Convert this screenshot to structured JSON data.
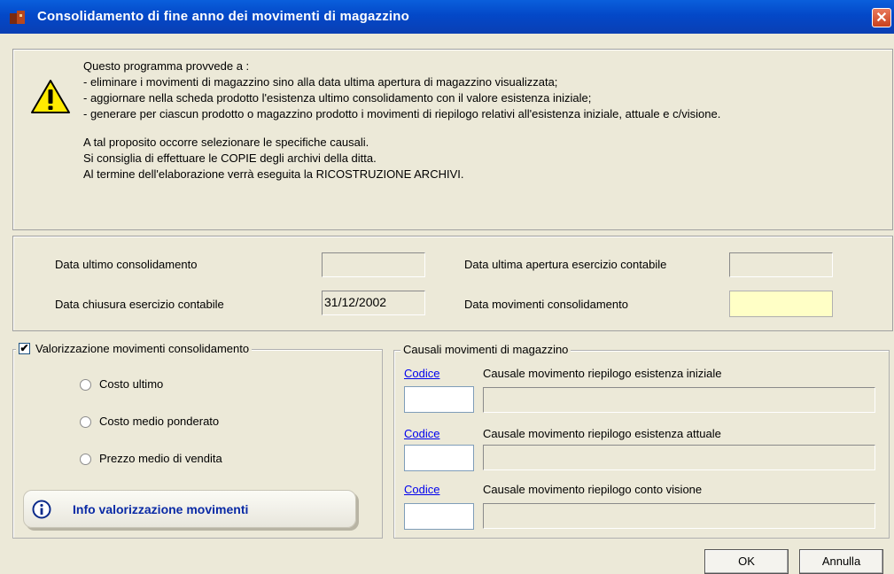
{
  "window": {
    "title": "Consolidamento di fine anno dei movimenti di magazzino",
    "close_label": "✕"
  },
  "info": {
    "lines": [
      "Questo programma provvede a :",
      "- eliminare i movimenti di magazzino sino alla data ultima apertura di magazzino visualizzata;",
      "- aggiornare nella scheda prodotto l'esistenza ultimo consolidamento con il valore esistenza iniziale;",
      "- generare per ciascun prodotto o magazzino prodotto i movimenti di riepilogo relativi all'esistenza iniziale, attuale e c/visione.",
      "",
      "A tal proposito occorre selezionare le specifiche causali.",
      "Si consiglia di effettuare le COPIE degli archivi della ditta.",
      "Al termine dell'elaborazione verrà eseguita la RICOSTRUZIONE ARCHIVI."
    ]
  },
  "dates": {
    "ultimo_consolidamento_label": "Data ultimo consolidamento",
    "ultimo_consolidamento_value": "",
    "ultima_apertura_label": "Data ultima apertura esercizio contabile",
    "ultima_apertura_value": "",
    "chiusura_label": "Data chiusura esercizio contabile",
    "chiusura_value": "31/12/2002",
    "movimenti_label": "Data movimenti consolidamento",
    "movimenti_value": ""
  },
  "valorizzazione": {
    "checkbox_label": "Valorizzazione movimenti consolidamento",
    "checked": true,
    "options": [
      "Costo ultimo",
      "Costo medio ponderato",
      "Prezzo medio di vendita"
    ],
    "info_button": "Info valorizzazione movimenti"
  },
  "causali": {
    "group_label": "Causali movimenti di magazzino",
    "codice_label": "Codice",
    "rows": [
      {
        "label": "Causale movimento riepilogo esistenza iniziale"
      },
      {
        "label": "Causale movimento riepilogo esistenza attuale"
      },
      {
        "label": "Causale movimento riepilogo conto visione"
      }
    ]
  },
  "buttons": {
    "ok": "OK",
    "cancel": "Annulla"
  },
  "colors": {
    "titlebar": "#0348c8",
    "window_bg": "#ece9d8",
    "highlight_field": "#ffffc6",
    "link": "#0000ee"
  }
}
